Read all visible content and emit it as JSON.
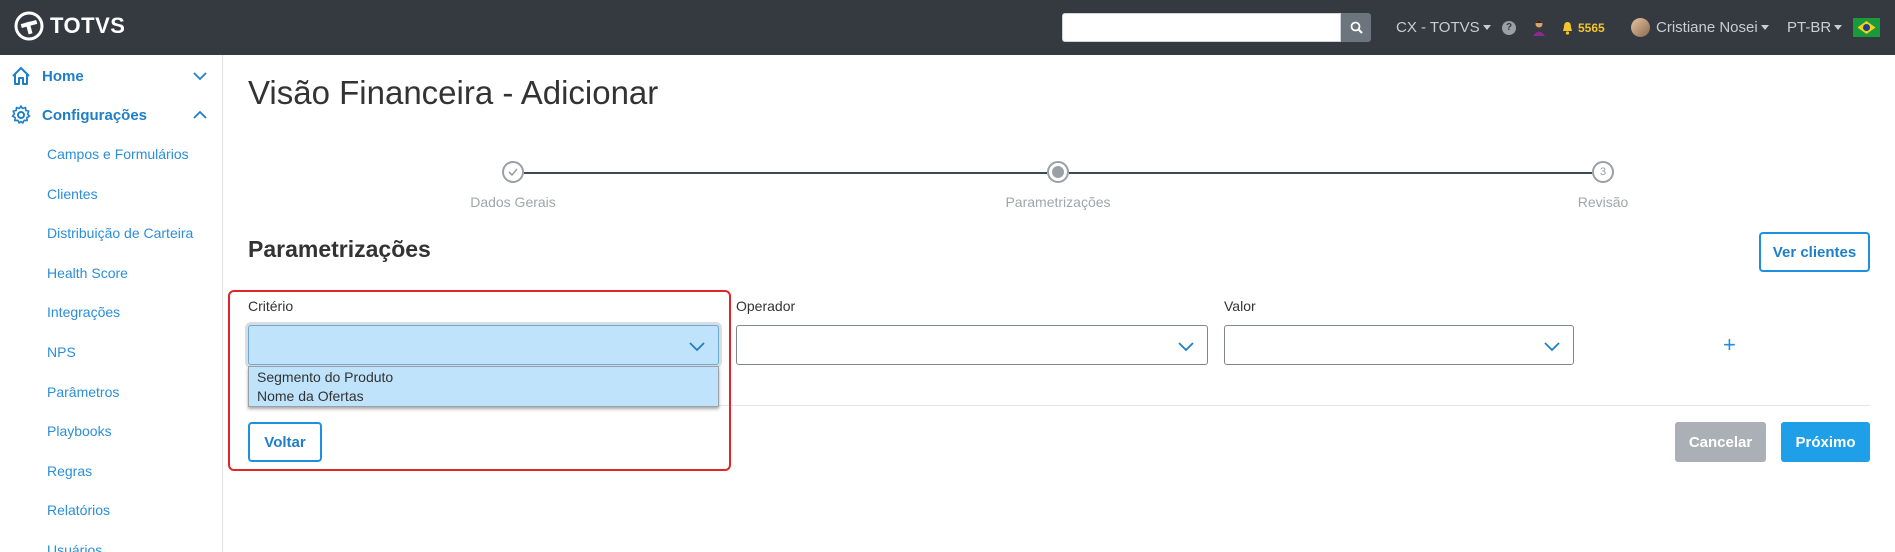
{
  "app": {
    "logo_text": "TOTVS"
  },
  "header": {
    "search_placeholder": "",
    "workspace": "CX - TOTVS",
    "help": "?",
    "notification_count": "5565",
    "user_name": "Cristiane Nosei",
    "language": "PT-BR"
  },
  "sidebar": {
    "home": "Home",
    "configuracoes": "Configurações",
    "items": [
      "Campos e Formulários",
      "Clientes",
      "Distribuição de Carteira",
      "Health Score",
      "Integrações",
      "NPS",
      "Parâmetros",
      "Playbooks",
      "Regras",
      "Relatórios",
      "Usuários"
    ]
  },
  "page": {
    "title": "Visão Financeira - Adicionar"
  },
  "stepper": {
    "steps": [
      {
        "label": "Dados Gerais",
        "state": "done"
      },
      {
        "label": "Parametrizações",
        "state": "current"
      },
      {
        "label": "Revisão",
        "state": "pending",
        "number": "3"
      }
    ]
  },
  "section": {
    "title": "Parametrizações",
    "ver_clientes": "Ver clientes"
  },
  "form": {
    "criterio_label": "Critério",
    "operador_label": "Operador",
    "valor_label": "Valor",
    "criterio_options": [
      "Segmento do Produto",
      "Nome da Ofertas"
    ],
    "add": "+"
  },
  "actions": {
    "voltar": "Voltar",
    "cancelar": "Cancelar",
    "proximo": "Próximo"
  },
  "colors": {
    "topbar": "#343a40",
    "accent": "#1f8fe0",
    "highlight": "#e0252b",
    "select_active": "#bfe3fa"
  }
}
